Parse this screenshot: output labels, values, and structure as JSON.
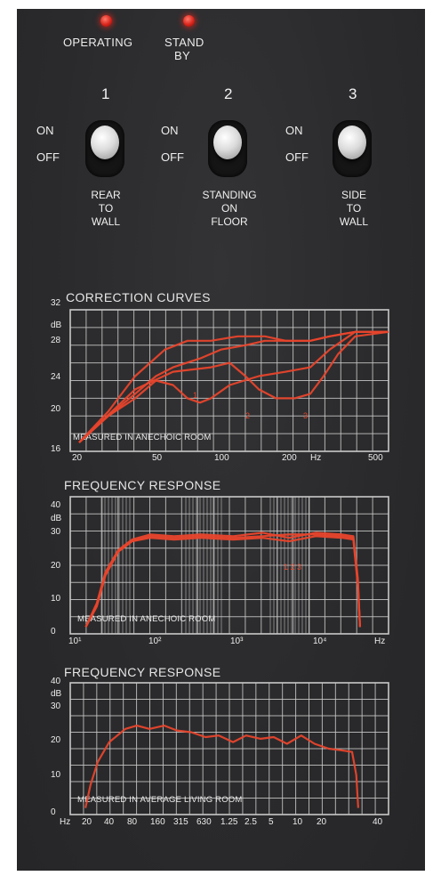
{
  "indicators": {
    "operating": "OPERATING",
    "standby_line1": "STAND",
    "standby_line2": "BY",
    "led_color": "#e0281d"
  },
  "switches": [
    {
      "number": "1",
      "on": "ON",
      "off": "OFF",
      "label_lines": [
        "REAR",
        "TO",
        "WALL"
      ]
    },
    {
      "number": "2",
      "on": "ON",
      "off": "OFF",
      "label_lines": [
        "STANDING",
        "ON",
        "FLOOR"
      ]
    },
    {
      "number": "3",
      "on": "ON",
      "off": "OFF",
      "label_lines": [
        "SIDE",
        "TO",
        "WALL"
      ]
    }
  ],
  "colors": {
    "panel": "#2b2b2d",
    "grid": "#c9c9c9",
    "curve": "#e8452c",
    "text": "#ececec"
  },
  "chart_data": [
    {
      "type": "line",
      "title": "CORRECTION CURVES",
      "note": "MEASURED IN ANECHOIC ROOM",
      "xscale": "log",
      "x_ticks": [
        "20",
        "50",
        "100",
        "200",
        "Hz",
        "500"
      ],
      "y_ticks": [
        "32",
        "dB",
        "28",
        "24",
        "20",
        "16"
      ],
      "ylim": [
        16,
        32
      ],
      "curve_labels": [
        "1",
        "2",
        "3"
      ],
      "series": [
        {
          "x": [
            22,
            30,
            40,
            55,
            70,
            90,
            120,
            160,
            200,
            260,
            320,
            420,
            600
          ],
          "y": [
            17,
            20.5,
            24.5,
            27.5,
            28.5,
            28.5,
            29,
            29,
            28.5,
            28.5,
            29,
            29.5,
            29.5
          ]
        },
        {
          "x": [
            22,
            30,
            40,
            50,
            60,
            80,
            100,
            130,
            160,
            200,
            260,
            320,
            420,
            600
          ],
          "y": [
            17,
            20,
            22.5,
            24.5,
            25.5,
            26.5,
            27.5,
            28,
            28.5,
            28.5,
            28.5,
            29,
            29.5,
            29.5
          ]
        },
        {
          "x": [
            22,
            30,
            40,
            50,
            60,
            70,
            80,
            90,
            110,
            150,
            200,
            260,
            320,
            420,
            600
          ],
          "y": [
            17,
            20,
            22,
            24,
            23.5,
            22,
            21.5,
            22,
            23.5,
            24.5,
            25,
            25.5,
            27.5,
            29.5,
            29.5
          ]
        },
        {
          "x": [
            22,
            40,
            60,
            90,
            110,
            130,
            150,
            180,
            220,
            260,
            300,
            350,
            420,
            600
          ],
          "y": [
            17,
            23,
            25,
            25.5,
            26,
            24.5,
            23,
            22,
            22,
            22.5,
            24.5,
            27,
            29,
            29.5
          ]
        }
      ]
    },
    {
      "type": "line",
      "title": "FREQUENCY RESPONSE",
      "note": "MEASURED IN ANECHOIC ROOM",
      "xscale": "log",
      "x_ticks": [
        "10¹",
        "10²",
        "10³",
        "10⁴",
        "Hz"
      ],
      "y_ticks": [
        "40",
        "dB",
        "30",
        "20",
        "10",
        "0"
      ],
      "ylim": [
        0,
        40
      ],
      "curve_labels": [
        "1 2 3"
      ],
      "series": [
        {
          "x": [
            15,
            20,
            25,
            35,
            50,
            80,
            150,
            300,
            700,
            1500,
            3000,
            6000,
            12000,
            16000,
            18000,
            19000
          ],
          "y": [
            2,
            8,
            17,
            24,
            27,
            28.5,
            28,
            28.5,
            28,
            28.5,
            29,
            29,
            28.5,
            28,
            15,
            2
          ]
        },
        {
          "x": [
            15,
            20,
            25,
            35,
            50,
            80,
            150,
            300,
            700,
            1500,
            3000,
            6000,
            12000,
            16000,
            18000,
            19000
          ],
          "y": [
            2,
            9,
            18,
            24.5,
            27.5,
            29,
            28.5,
            29,
            28.5,
            29.5,
            28,
            29.5,
            29,
            28.5,
            16,
            2
          ]
        },
        {
          "x": [
            15,
            20,
            25,
            35,
            50,
            80,
            150,
            300,
            700,
            1500,
            3000,
            6000,
            12000,
            16000,
            18000,
            19000
          ],
          "y": [
            2,
            8.5,
            17.5,
            24,
            27,
            28,
            27.5,
            28,
            27.5,
            28,
            27,
            28.5,
            28,
            27.5,
            14,
            2
          ]
        }
      ]
    },
    {
      "type": "line",
      "title": "FREQUENCY RESPONSE",
      "note": "MEASURED IN AVERAGE LIVING ROOM",
      "xscale": "log",
      "x_ticks": [
        "Hz",
        "20",
        "40",
        "80",
        "160",
        "315",
        "630",
        "1.25",
        "2.5",
        "5",
        "10",
        "20",
        "40"
      ],
      "y_ticks": [
        "40",
        "dB",
        "30",
        "20",
        "10",
        "0"
      ],
      "ylim": [
        0,
        40
      ],
      "series": [
        {
          "x": [
            22,
            25,
            30,
            40,
            60,
            80,
            110,
            160,
            220,
            315,
            450,
            630,
            900,
            1250,
            1800,
            2500,
            3500,
            5000,
            7000,
            10000,
            14000,
            18000,
            20000,
            21000
          ],
          "y": [
            2,
            9,
            16,
            22,
            26,
            27,
            26,
            27,
            25.5,
            25,
            23.5,
            24,
            22,
            24,
            23,
            23.5,
            21.5,
            24,
            21.5,
            20,
            19.5,
            19,
            12,
            2
          ]
        }
      ]
    }
  ]
}
